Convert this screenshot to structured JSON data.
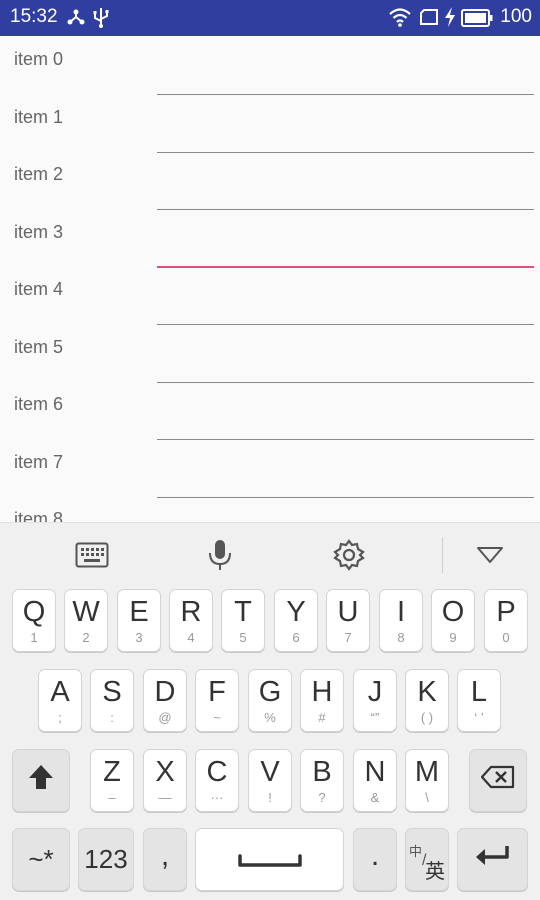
{
  "status_bar": {
    "time": "15:32",
    "battery_level": "100",
    "icons": [
      "network-share-icon",
      "usb-icon",
      "wifi-icon",
      "sim-icon",
      "charging-icon",
      "battery-icon"
    ]
  },
  "list": {
    "focused_index": 3,
    "items": [
      {
        "label": "item 0",
        "value": ""
      },
      {
        "label": "item 1",
        "value": ""
      },
      {
        "label": "item 2",
        "value": ""
      },
      {
        "label": "item 3",
        "value": ""
      },
      {
        "label": "item 4",
        "value": ""
      },
      {
        "label": "item 5",
        "value": ""
      },
      {
        "label": "item 6",
        "value": ""
      },
      {
        "label": "item 7",
        "value": ""
      },
      {
        "label": "item 8",
        "value": ""
      }
    ]
  },
  "keyboard": {
    "toolbar": [
      "keyboard-icon",
      "microphone-icon",
      "settings-icon",
      "collapse-icon"
    ],
    "row1": [
      {
        "main": "Q",
        "sub": "1"
      },
      {
        "main": "W",
        "sub": "2"
      },
      {
        "main": "E",
        "sub": "3"
      },
      {
        "main": "R",
        "sub": "4"
      },
      {
        "main": "T",
        "sub": "5"
      },
      {
        "main": "Y",
        "sub": "6"
      },
      {
        "main": "U",
        "sub": "7"
      },
      {
        "main": "I",
        "sub": "8"
      },
      {
        "main": "O",
        "sub": "9"
      },
      {
        "main": "P",
        "sub": "0"
      }
    ],
    "row2": [
      {
        "main": "A",
        "sub": ";"
      },
      {
        "main": "S",
        "sub": ":"
      },
      {
        "main": "D",
        "sub": "@"
      },
      {
        "main": "F",
        "sub": "~"
      },
      {
        "main": "G",
        "sub": "%"
      },
      {
        "main": "H",
        "sub": "#"
      },
      {
        "main": "J",
        "sub": "“”"
      },
      {
        "main": "K",
        "sub": "( )"
      },
      {
        "main": "L",
        "sub": "‘ ’"
      }
    ],
    "row3": [
      {
        "main": "Z",
        "sub": "–"
      },
      {
        "main": "X",
        "sub": "—"
      },
      {
        "main": "C",
        "sub": "···"
      },
      {
        "main": "V",
        "sub": "!"
      },
      {
        "main": "B",
        "sub": "?"
      },
      {
        "main": "N",
        "sub": "&"
      },
      {
        "main": "M",
        "sub": "\\"
      }
    ],
    "bottom": {
      "symbols": "~*",
      "numbers": "123",
      "comma": ",",
      "period": ".",
      "lang_small": "中",
      "lang_big": "英"
    }
  }
}
